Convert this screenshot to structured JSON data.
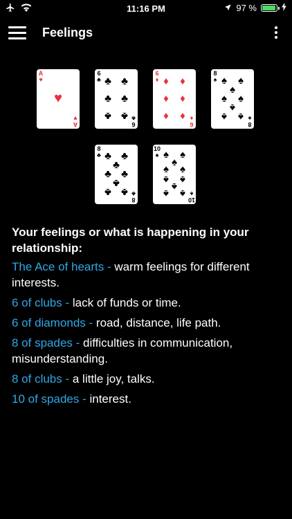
{
  "status_bar": {
    "time": "11:16 PM",
    "battery_percent": "97 %",
    "battery_level": 0.97,
    "icons": [
      "airplane-icon",
      "wifi-icon",
      "location-icon",
      "battery-icon",
      "charging-icon"
    ]
  },
  "nav": {
    "title": "Feelings",
    "menu_icon": "hamburger-menu-icon",
    "more_icon": "vertical-more-icon"
  },
  "cards": [
    {
      "rank": "A",
      "suit": "hearts",
      "symbol": "♥",
      "color": "#e8323c"
    },
    {
      "rank": "6",
      "suit": "clubs",
      "symbol": "♣",
      "color": "#000000"
    },
    {
      "rank": "6",
      "suit": "diamonds",
      "symbol": "♦",
      "color": "#e8323c"
    },
    {
      "rank": "8",
      "suit": "spades",
      "symbol": "♠",
      "color": "#000000"
    },
    {
      "rank": "8",
      "suit": "clubs",
      "symbol": "♣",
      "color": "#000000"
    },
    {
      "rank": "10",
      "suit": "spades",
      "symbol": "♠",
      "color": "#000000"
    }
  ],
  "content": {
    "heading": "Your feelings or what is happening in your relationship:",
    "readings": [
      {
        "card": "The Ace of hearts - ",
        "meaning": "warm feelings for different interests."
      },
      {
        "card": "6 of clubs - ",
        "meaning": "lack of funds or time."
      },
      {
        "card": "6 of diamonds - ",
        "meaning": "road, distance, life path."
      },
      {
        "card": "8 of spades - ",
        "meaning": "difficulties in communication, misunderstanding."
      },
      {
        "card": "8 of clubs - ",
        "meaning": "a little joy, talks."
      },
      {
        "card": "10 of spades - ",
        "meaning": "interest."
      }
    ]
  },
  "colors": {
    "background": "#000000",
    "accent": "#2fa8e6",
    "red_suit": "#e8323c",
    "battery_green": "#4cd964"
  }
}
